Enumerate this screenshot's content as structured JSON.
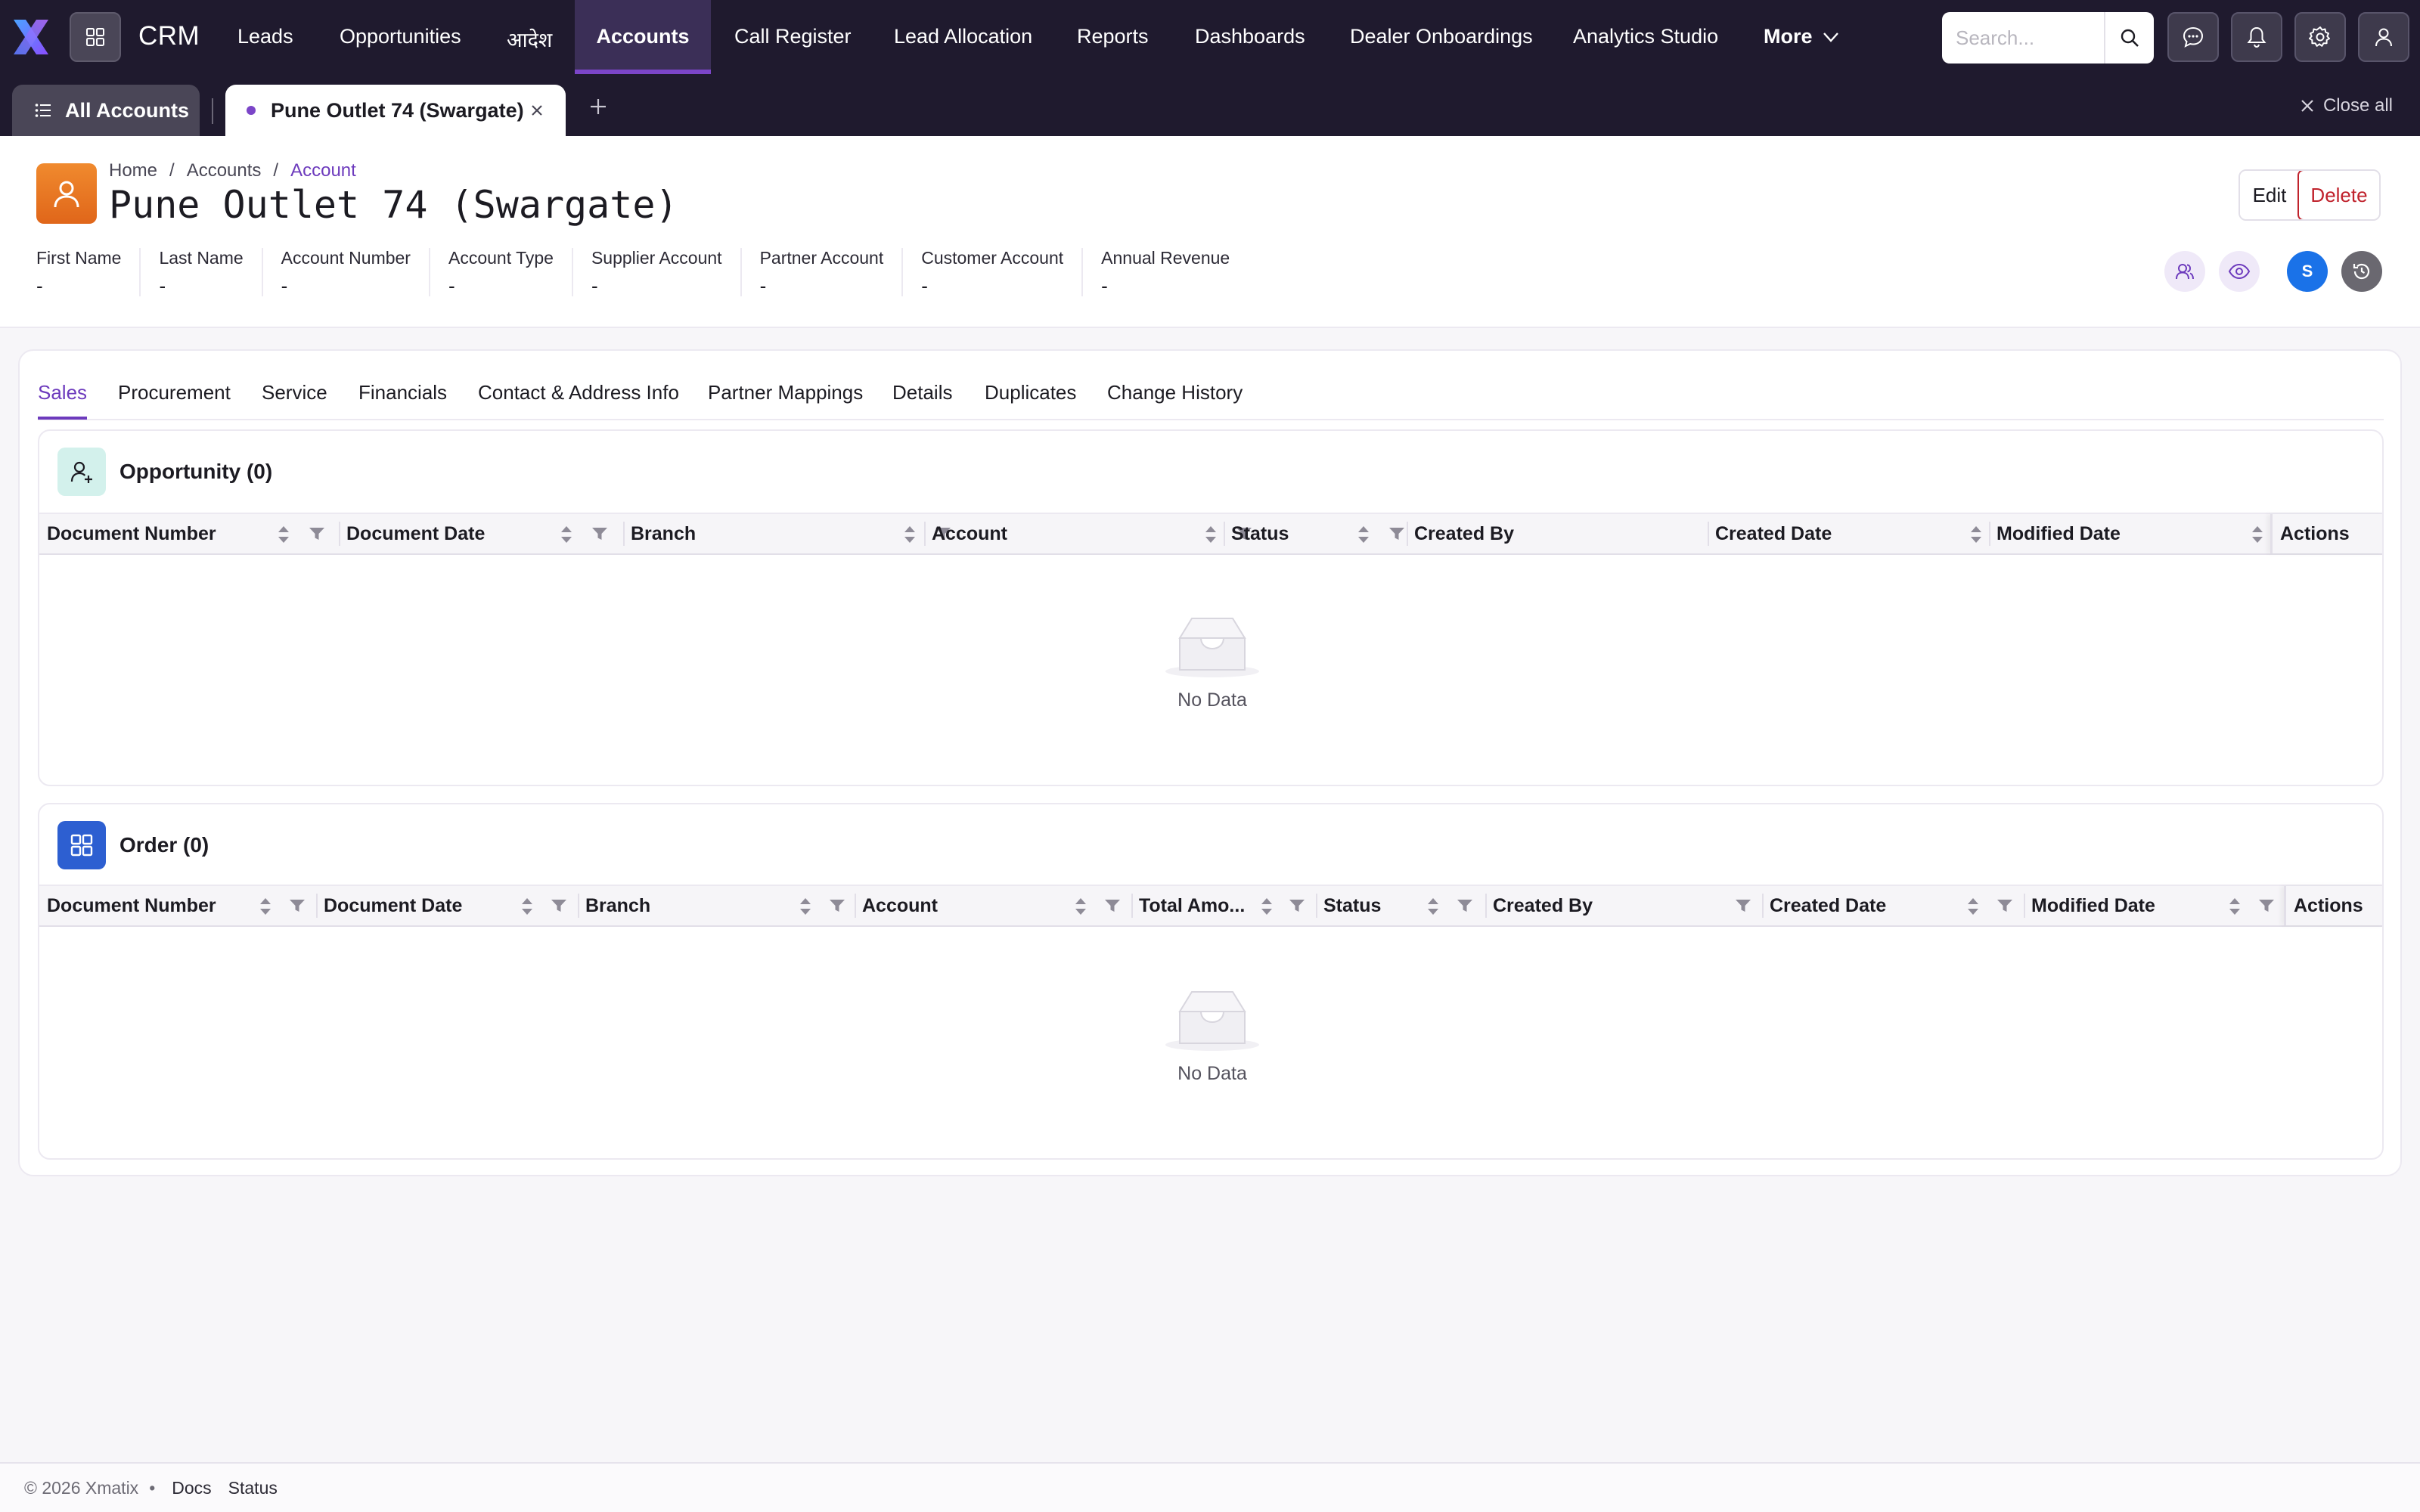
{
  "app": {
    "name": "CRM",
    "nav": [
      "Leads",
      "Opportunities",
      "आदेश",
      "Accounts",
      "Call Register",
      "Lead Allocation",
      "Reports",
      "Dashboards",
      "Dealer Onboardings",
      "Analytics Studio"
    ],
    "nav_active": "Accounts",
    "more_label": "More",
    "search_placeholder": "Search..."
  },
  "tabs": {
    "all_label": "All Accounts",
    "open_tab": "Pune Outlet 74 (Swargate)",
    "close_all": "Close all"
  },
  "header": {
    "breadcrumb": [
      "Home",
      "Accounts",
      "Account"
    ],
    "title": "Pune Outlet 74 (Swargate)",
    "edit_label": "Edit",
    "delete_label": "Delete",
    "avatar_initial": "S",
    "fields": [
      {
        "label": "First Name",
        "value": "-"
      },
      {
        "label": "Last Name",
        "value": "-"
      },
      {
        "label": "Account Number",
        "value": "-"
      },
      {
        "label": "Account Type",
        "value": "-"
      },
      {
        "label": "Supplier Account",
        "value": "-"
      },
      {
        "label": "Partner Account",
        "value": "-"
      },
      {
        "label": "Customer Account",
        "value": "-"
      },
      {
        "label": "Annual Revenue",
        "value": "-"
      }
    ]
  },
  "subtabs": [
    "Sales",
    "Procurement",
    "Service",
    "Financials",
    "Contact & Address Info",
    "Partner Mappings",
    "Details",
    "Duplicates",
    "Change History"
  ],
  "subtab_active": "Sales",
  "opportunity": {
    "title": "Opportunity (0)",
    "columns": [
      "Document Number",
      "Document Date",
      "Branch",
      "Account",
      "Status",
      "Created By",
      "Created Date",
      "Modified Date",
      "Actions"
    ],
    "empty_text": "No Data"
  },
  "order": {
    "title": "Order (0)",
    "columns": [
      "Document Number",
      "Document Date",
      "Branch",
      "Account",
      "Total Amo...",
      "Status",
      "Created By",
      "Created Date",
      "Modified Date",
      "Actions"
    ],
    "empty_text": "No Data"
  },
  "footer": {
    "copyright": "© 2026 Xmatix",
    "links": [
      "Docs",
      "Status"
    ]
  },
  "colors": {
    "nav_bg": "#1f1a2e",
    "accent": "#6d3bbd",
    "delete": "#c0222c",
    "avatar": "#f08a2e"
  }
}
